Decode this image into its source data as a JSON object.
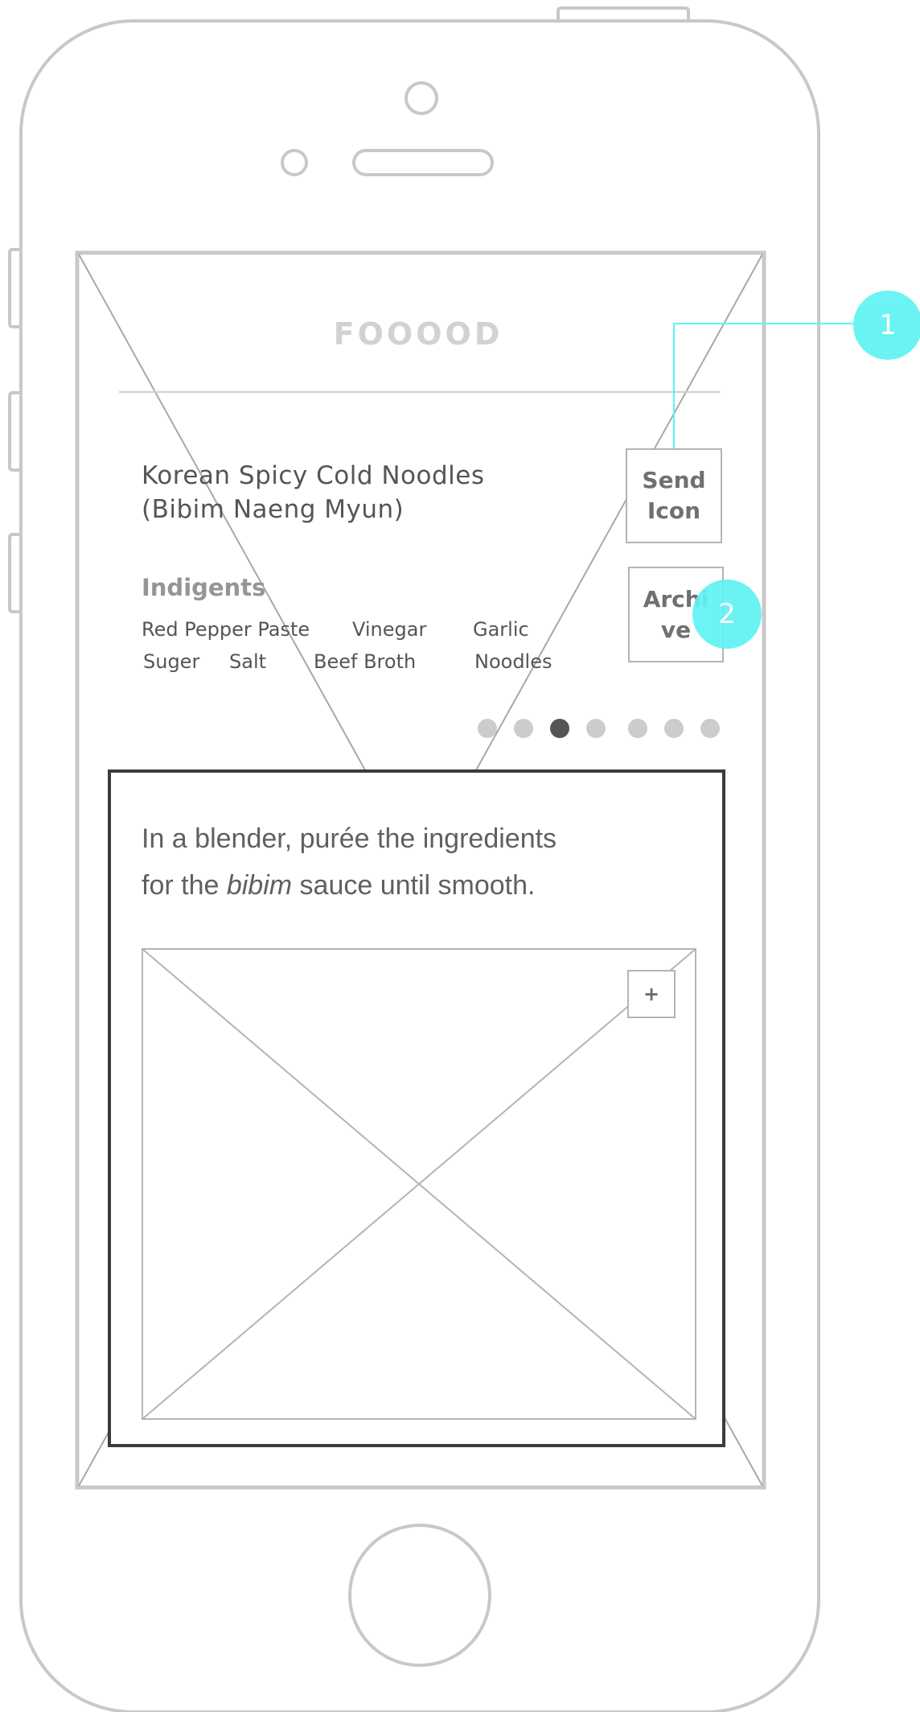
{
  "header": {
    "app_title": "FOOOOD"
  },
  "recipe": {
    "title_line1": "Korean Spicy Cold Noodles",
    "title_line2": "(Bibim Naeng Myun)",
    "ingredients_label": "Indigents",
    "ingredients": [
      "Red Pepper Paste",
      "Vinegar",
      "Garlic",
      "Suger",
      "Salt",
      "Beef Broth",
      "Noodles"
    ]
  },
  "actions": {
    "send_label_line1": "Send",
    "send_label_line2": "Icon",
    "archive_label_line1": "Archi",
    "archive_label_line2": "ve"
  },
  "annotations": {
    "callout_1": "1",
    "callout_2": "2"
  },
  "carousel": {
    "total_pages": 7,
    "current_page": 3
  },
  "step": {
    "text_before": "In a blender, purée the ingredients",
    "text_for": "for the",
    "text_emphasis": "bibim",
    "text_after": "sauce until smooth."
  },
  "image_placeholder": {
    "expand_label": "+"
  },
  "colors": {
    "outline": "#c8c8c8",
    "accent": "#5ff2f4",
    "card_border": "#3b3b3b",
    "dot_active": "#555555",
    "dot_inactive": "#cccccc"
  }
}
